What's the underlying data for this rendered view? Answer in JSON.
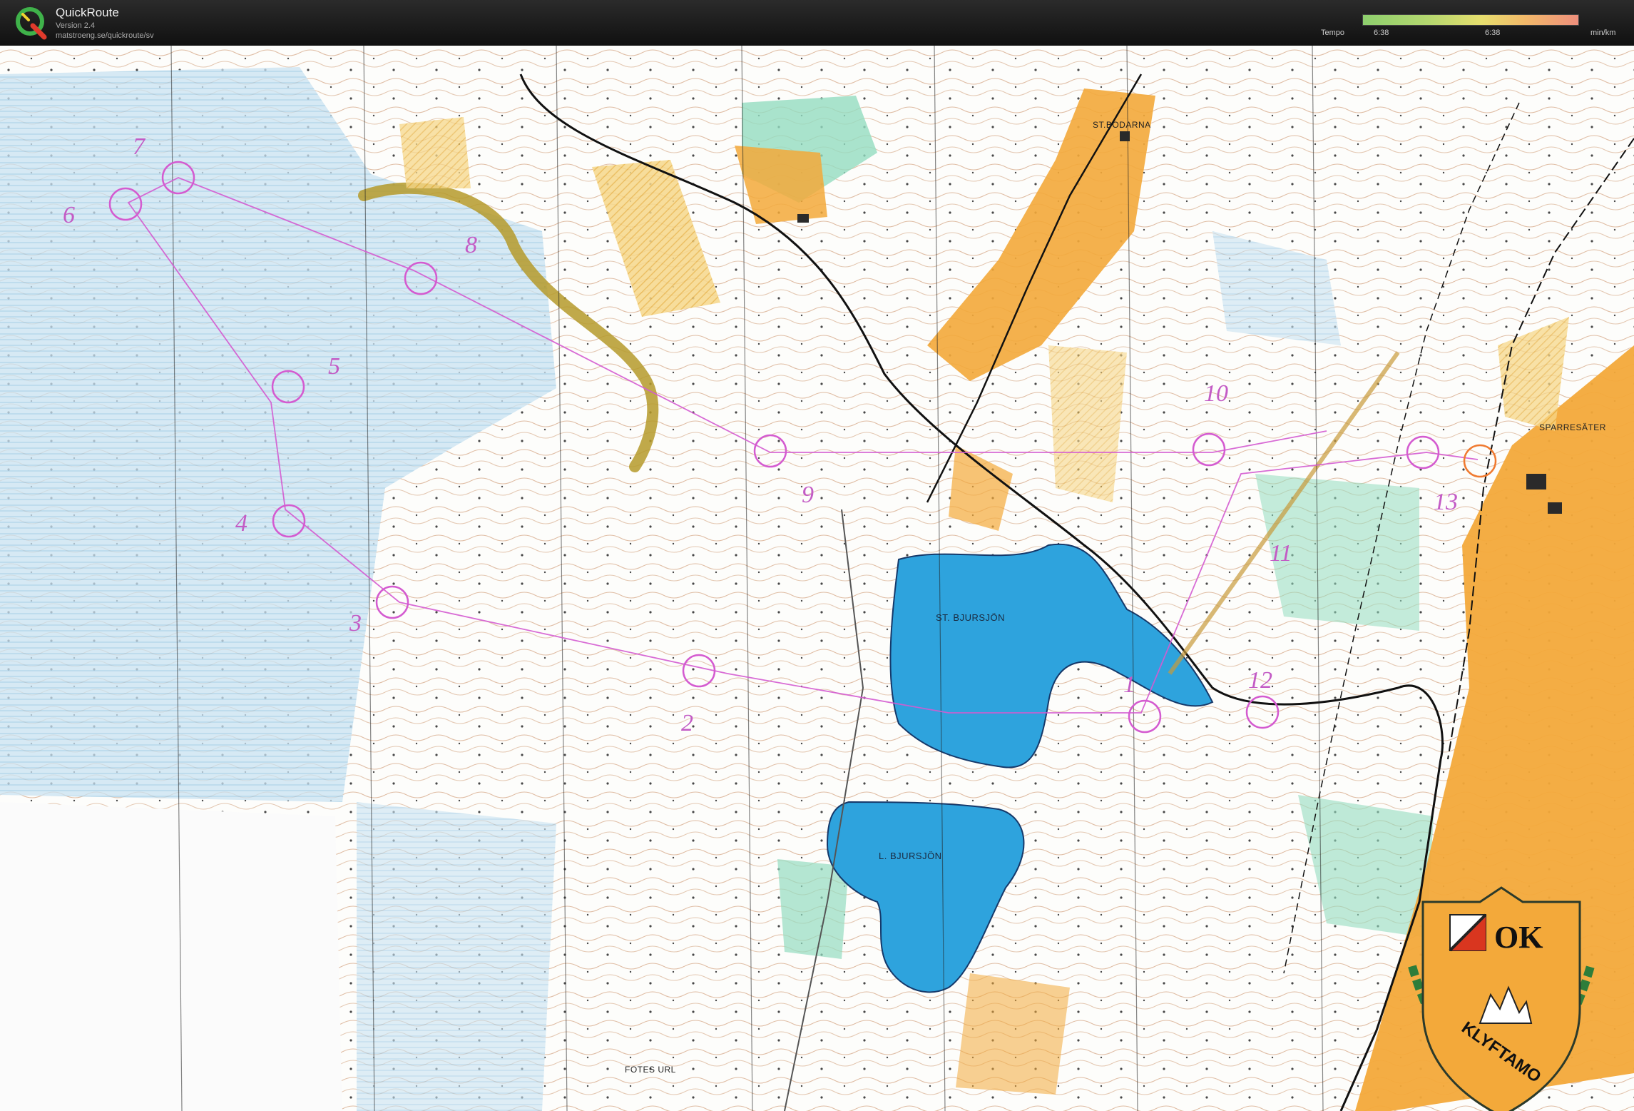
{
  "app": {
    "title": "QuickRoute",
    "version": "Version 2.4",
    "url": "matstroeng.se/quickroute/sv",
    "logo_icon": "quickroute-q-logo"
  },
  "tempo": {
    "label": "Tempo",
    "min_value": "6:38",
    "max_value": "6:38",
    "unit": "min/km",
    "gradient_colors": [
      "#8ecf6e",
      "#e6de6e",
      "#ee8f7c"
    ]
  },
  "map": {
    "lakes": [
      "ST. BJURSJÖN",
      "L. BJURSJÖN"
    ],
    "places": [
      "ST.BODARNA",
      "SPARRESÄTER",
      "FOTES URL"
    ],
    "controls": [
      "1",
      "2",
      "3",
      "4",
      "5",
      "6",
      "7",
      "8",
      "9",
      "10",
      "11",
      "12",
      "13"
    ],
    "club_logo_text": [
      "OK",
      "KLYFTAMO"
    ],
    "colors": {
      "water": "#2ea3dd",
      "marsh_blue": "#bcdcef",
      "open_land": "#f3a93a",
      "green": "#94dcc0",
      "course": "#d45bd0",
      "contour": "#b86a3a"
    }
  }
}
